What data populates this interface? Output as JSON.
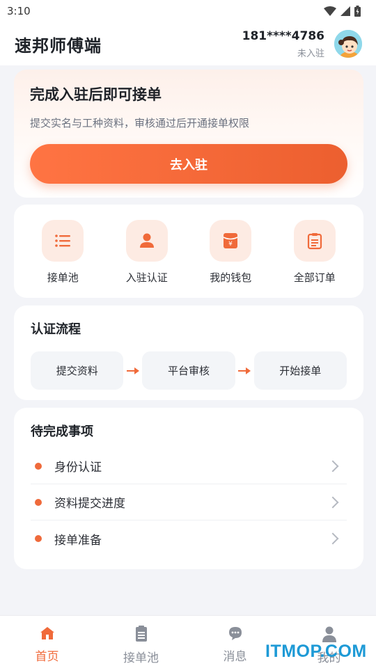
{
  "status_bar": {
    "time": "3:10"
  },
  "header": {
    "app_title": "速邦师傅端",
    "phone": "181****4786",
    "user_status": "未入驻"
  },
  "hero": {
    "title": "完成入驻后即可接单",
    "subtitle": "提交实名与工种资料，审核通过后开通接单权限",
    "button_label": "去入驻"
  },
  "quick_actions": [
    {
      "label": "接单池",
      "icon": "list-icon"
    },
    {
      "label": "入驻认证",
      "icon": "person-icon"
    },
    {
      "label": "我的钱包",
      "icon": "wallet-icon"
    },
    {
      "label": "全部订单",
      "icon": "clipboard-icon"
    }
  ],
  "flow": {
    "title": "认证流程",
    "steps": [
      "提交资料",
      "平台审核",
      "开始接单"
    ]
  },
  "todo": {
    "title": "待完成事项",
    "items": [
      "身份认证",
      "资料提交进度",
      "接单准备"
    ]
  },
  "tabbar": {
    "tabs": [
      {
        "label": "首页",
        "icon": "home-icon",
        "active": true
      },
      {
        "label": "接单池",
        "icon": "document-icon",
        "active": false
      },
      {
        "label": "消息",
        "icon": "chat-icon",
        "active": false
      },
      {
        "label": "我的",
        "icon": "user-icon",
        "active": false
      }
    ]
  },
  "watermark": "ITMOP.COM",
  "colors": {
    "accent": "#f06a3a",
    "accent_light": "#fdebe3",
    "background": "#f3f4f8"
  }
}
